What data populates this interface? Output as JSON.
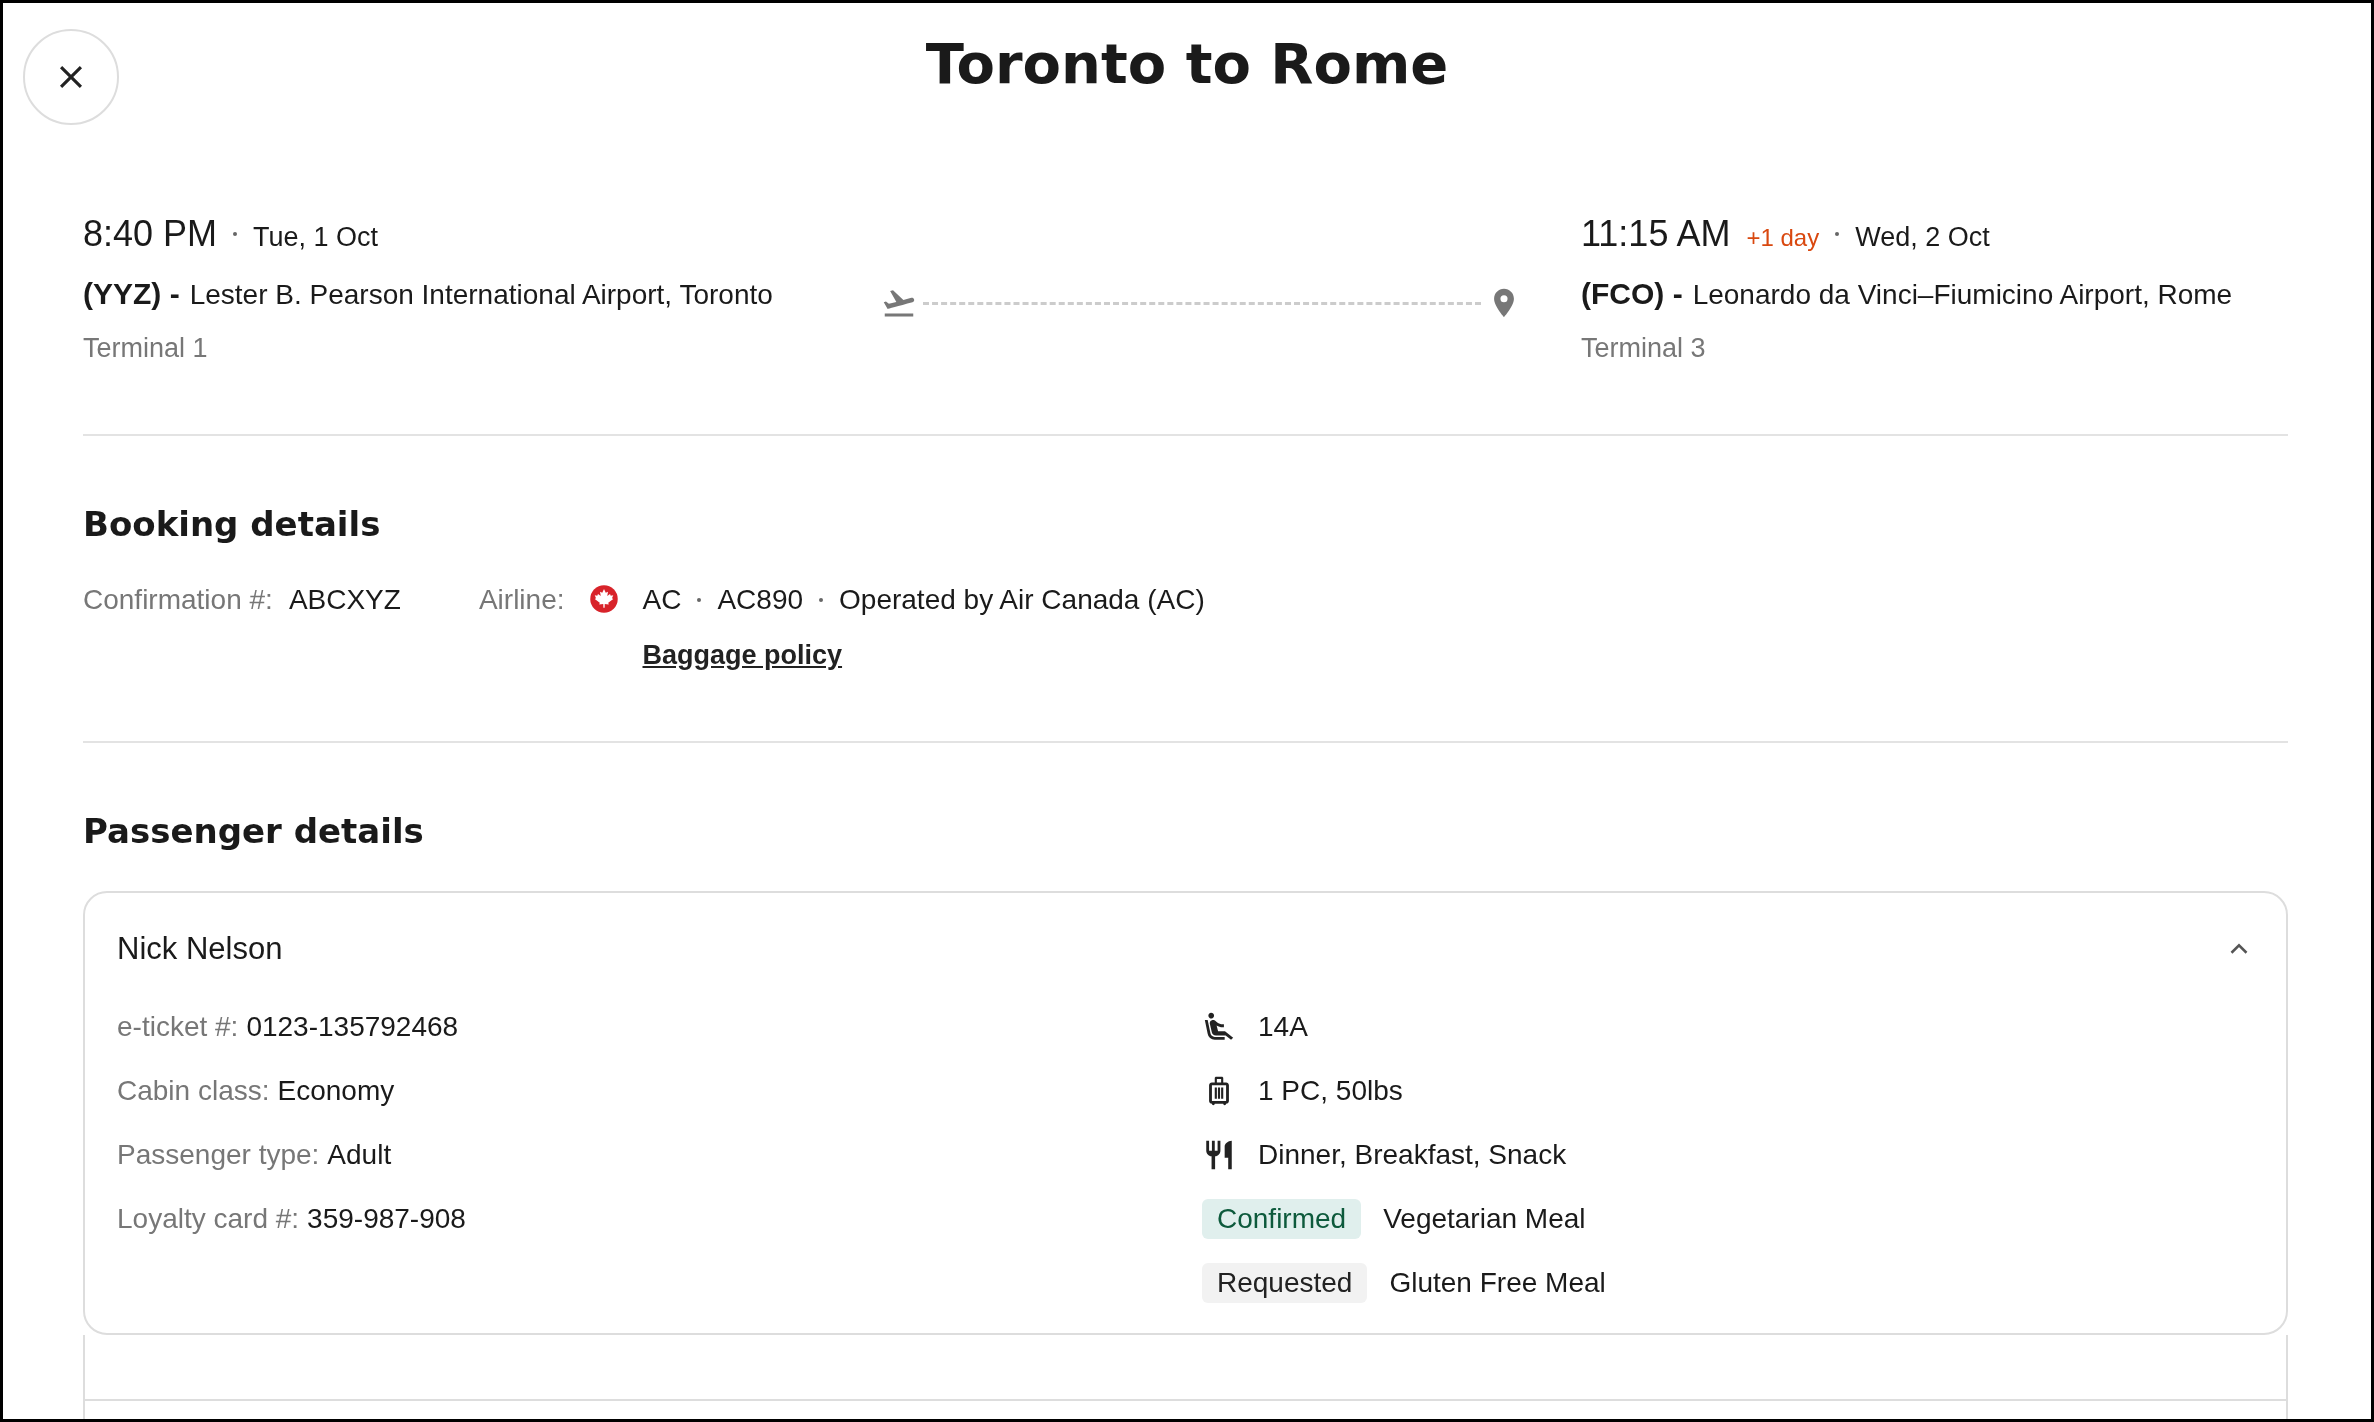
{
  "title": "Toronto to Rome",
  "departure": {
    "time": "8:40 PM",
    "date": "Tue, 1 Oct",
    "code": "(YYZ) -",
    "airport": "Lester B. Pearson International Airport, Toronto",
    "terminal": "Terminal 1"
  },
  "arrival": {
    "time": "11:15 AM",
    "day_offset": "+1 day",
    "date": "Wed, 2 Oct",
    "code": "(FCO) -",
    "airport": "Leonardo da Vinci–Fiumicino Airport, Rome",
    "terminal": "Terminal 3"
  },
  "booking": {
    "heading": "Booking details",
    "confirmation_label": "Confirmation #:",
    "confirmation_value": "ABCXYZ",
    "airline_label": "Airline:",
    "carrier": "AC",
    "flight_number": "AC890",
    "operated_by": "Operated by Air Canada (AC)",
    "baggage_link": "Baggage policy"
  },
  "passengers": {
    "heading": "Passenger details",
    "items": [
      {
        "name": "Nick Nelson",
        "expanded": true,
        "details": [
          {
            "label": "e-ticket #:",
            "value": "0123-135792468"
          },
          {
            "label": "Cabin class:",
            "value": "Economy"
          },
          {
            "label": "Passenger type:",
            "value": "Adult"
          },
          {
            "label": "Loyalty card #:",
            "value": "359-987-908"
          }
        ],
        "extras": [
          {
            "kind": "seat",
            "text": "14A"
          },
          {
            "kind": "baggage",
            "text": "1 PC, 50lbs"
          },
          {
            "kind": "meals",
            "text": "Dinner, Breakfast, Snack"
          }
        ],
        "meal_requests": [
          {
            "kind": "confirmed",
            "status": "Confirmed",
            "meal": "Vegetarian Meal"
          },
          {
            "kind": "requested",
            "status": "Requested",
            "meal": "Gluten Free Meal"
          }
        ]
      }
    ]
  }
}
